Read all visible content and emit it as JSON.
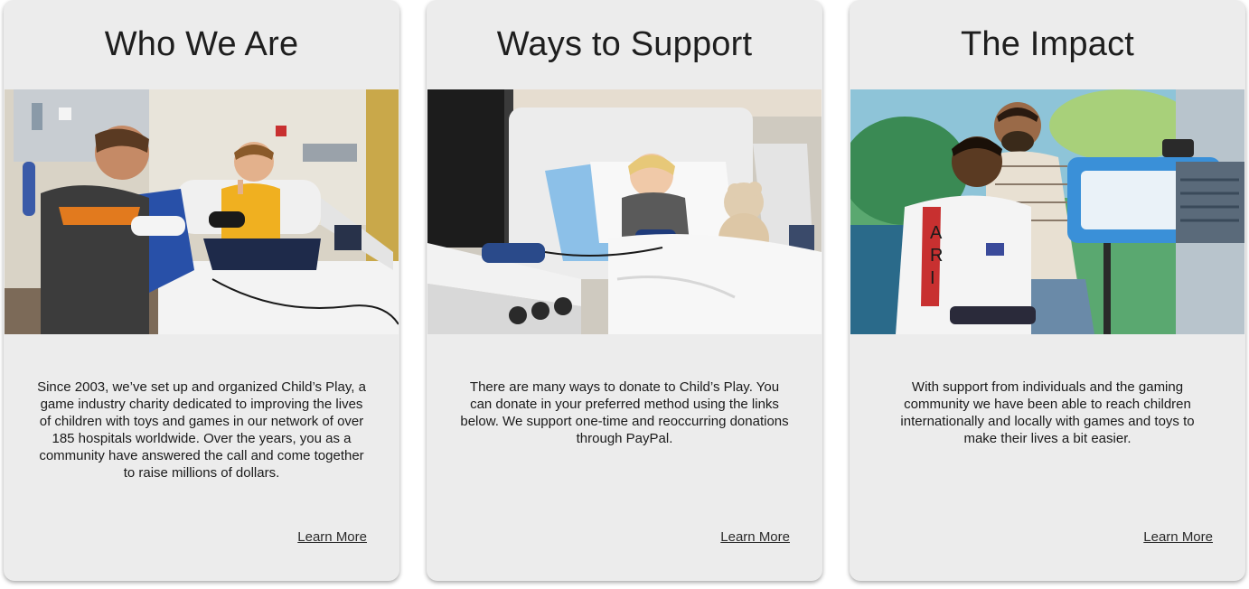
{
  "cards": [
    {
      "title": "Who We Are",
      "image_alt": "Man and boy playing video games with controllers on a hospital bed",
      "body": "Since 2003, we’ve set up and organized Child’s Play, a game industry charity dedicated to improving the lives of children with toys and games in our network of over 185 hospitals worldwide. Over the years, you as a community have answered the call and come together to raise millions of dollars.",
      "link_label": "Learn More"
    },
    {
      "title": "Ways to Support",
      "image_alt": "Smiling girl in hospital bed holding a game controller next to a teddy bear",
      "body": "There are many ways to donate to Child’s Play. You can donate in your preferred method using the links below. We support one-time and reoccurring donations through PayPal.",
      "link_label": "Learn More"
    },
    {
      "title": "The Impact",
      "image_alt": "Boy holding a handheld game with a man behind him next to a blue Starlight Fun Center",
      "body": "With support from individuals and the gaming community we have been able to reach children internationally and locally with games and toys to make their lives a bit easier.",
      "link_label": "Learn More"
    }
  ],
  "colors": {
    "card_background": "#ececec",
    "title_text": "#1e1e1e",
    "body_text": "#1a1a1a",
    "link_text": "#2a2a2a"
  }
}
